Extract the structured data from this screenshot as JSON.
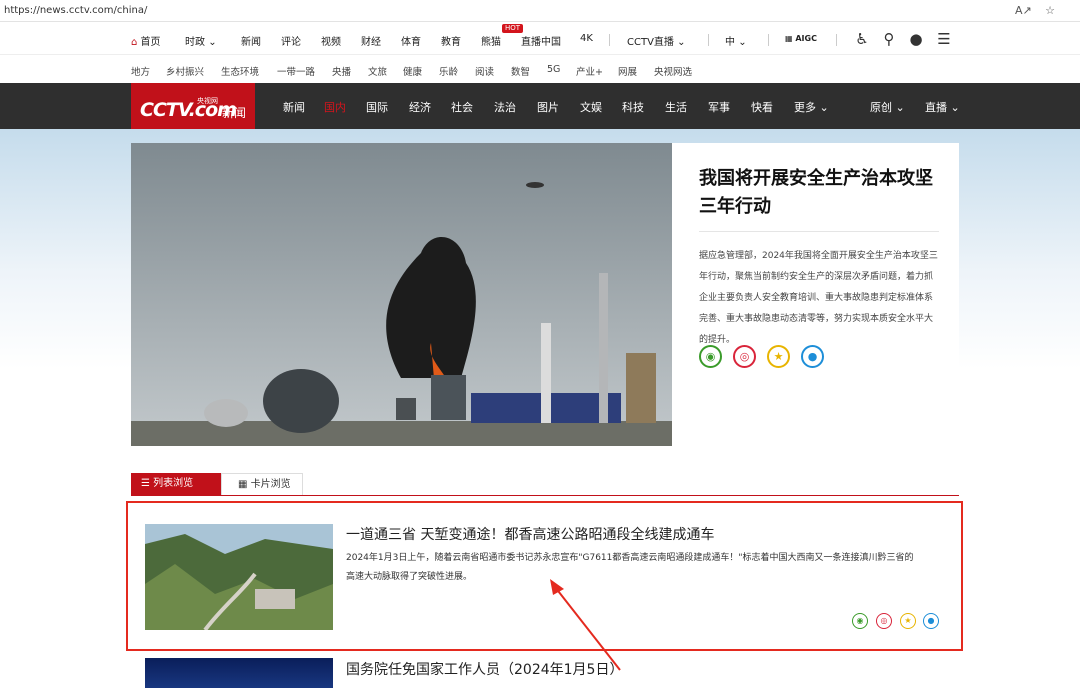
{
  "browser": {
    "url": "https://news.cctv.com/china/"
  },
  "topnav": {
    "items": [
      "首页",
      "时政",
      "新闻",
      "评论",
      "视频",
      "财经",
      "体育",
      "教育",
      "熊猫",
      "直播中国",
      "4K",
      "CCTV直播",
      "中"
    ],
    "hot_badge": "HOT",
    "aigc": "AIGC"
  },
  "subnav": {
    "items": [
      "地方",
      "乡村振兴",
      "生态环境",
      "一带一路",
      "央播",
      "文旅",
      "健康",
      "乐龄",
      "阅读",
      "数智",
      "5G",
      "产业+",
      "网展",
      "央视网选"
    ]
  },
  "logo": {
    "text": "CCTV.com",
    "small": "央视网",
    "name": "新闻"
  },
  "channels": {
    "items": [
      "新闻",
      "国内",
      "国际",
      "经济",
      "社会",
      "法治",
      "图片",
      "文娱",
      "科技",
      "生活",
      "军事",
      "快看",
      "更多"
    ],
    "active": "国内",
    "right": [
      "原创",
      "直播"
    ]
  },
  "hero": {
    "title": "我国将开展安全生产治本攻坚三年行动",
    "desc": "据应急管理部，2024年我国将全面开展安全生产治本攻坚三年行动，聚焦当前制约安全生产的深层次矛盾问题，着力抓企业主要负责人安全教育培训、重大事故隐患判定标准体系完善、重大事故隐患动态清零等，努力实现本质安全水平大的提升。"
  },
  "tabs": {
    "list": "列表浏览",
    "card": "卡片浏览"
  },
  "items": [
    {
      "title": "一道通三省 天堑变通途！都香高速公路昭通段全线建成通车",
      "desc": "2024年1月3日上午，随着云南省昭通市委书记苏永忠宣布\"G7611都香高速云南昭通段建成通车！\"标志着中国大西南又一条连接滇川黔三省的高速大动脉取得了突破性进展。"
    },
    {
      "title": "国务院任免国家工作人员（2024年1月5日）"
    }
  ],
  "colors": {
    "brand_red": "#c1111a",
    "channel_bar": "#2f2f2f",
    "highlight_box": "#e42a1f"
  }
}
